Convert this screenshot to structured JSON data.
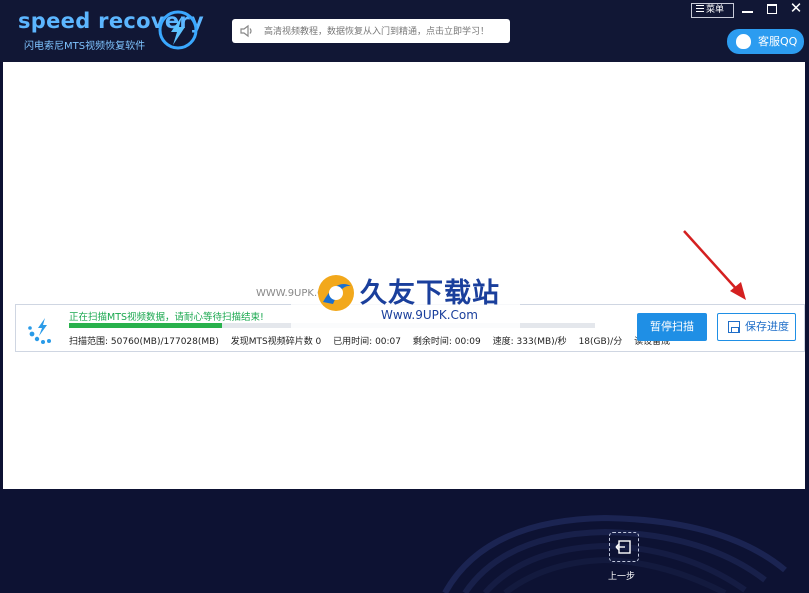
{
  "app": {
    "title": "speed recovery",
    "subtitle": "闪电索尼MTS视频恢复软件"
  },
  "header": {
    "notice": "高清视频教程，数据恢复从入门到精通，点击立即学习！",
    "menu_label": "菜单",
    "close_glyph": "✕",
    "qq_label": "客服QQ"
  },
  "scan": {
    "status": "正在扫描MTS视频数据，请耐心等待扫描结束!",
    "progress": 0.29,
    "range": "扫描范围: 50760(MB)/177028(MB)",
    "found": "发现MTS视频碎片数 0",
    "elapsed": "已用时间: 00:07",
    "remaining": "剩余时间: 00:09",
    "speed": "速度: 333(MB)/秒",
    "speed2": "18(GB)/分",
    "device": "读设备成",
    "pause_label": "暂停扫描",
    "save_label": "保存进度"
  },
  "watermark": {
    "title": "久友下载站",
    "url": "Www.9UPK.Com",
    "left": "WWW.9UPK.COM"
  },
  "footer": {
    "back_label": "上一步"
  },
  "colors": {
    "header_bg": "#111735",
    "accent": "#1f8fe5",
    "progress": "#28b14c",
    "arrow": "#d42020"
  }
}
